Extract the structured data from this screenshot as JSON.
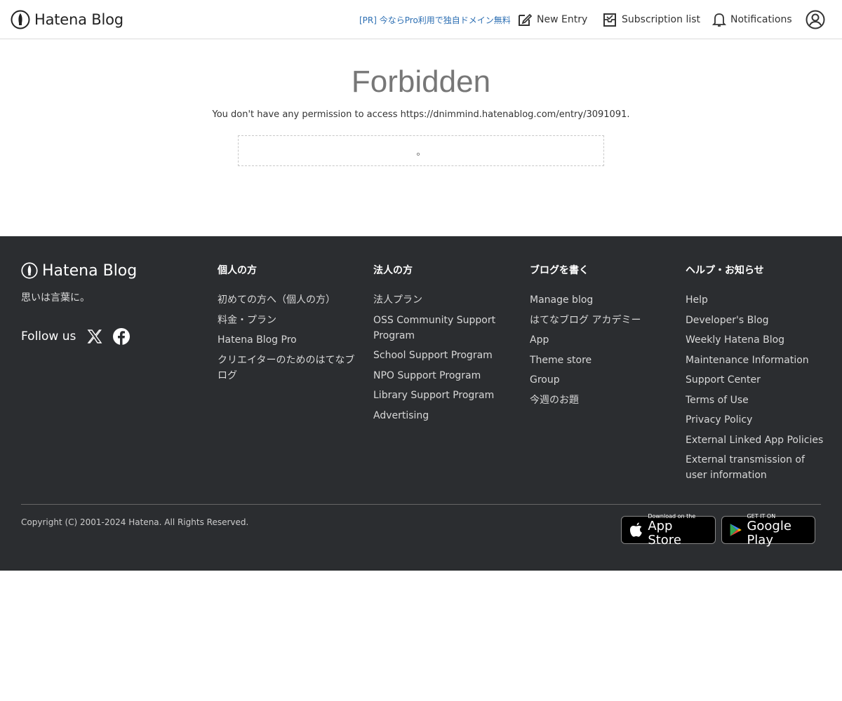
{
  "header": {
    "brand": "Hatena Blog",
    "pr_link": "[PR] 今ならPro利用で独自ドメイン無料",
    "new_entry": "New Entry",
    "subscription_list": "Subscription list",
    "notifications": "Notifications"
  },
  "main": {
    "title": "Forbidden",
    "message": "You don't have any permission to access https://dnimmind.hatenablog.com/entry/3091091.",
    "box_text": "。"
  },
  "footer": {
    "brand": "Hatena Blog",
    "tagline": "思いは言葉に。",
    "follow_label": "Follow us",
    "columns": [
      {
        "heading": "個人の方",
        "items": [
          "初めての方へ（個人の方）",
          "料金・プラン",
          "Hatena Blog Pro",
          "クリエイターのためのはてなブログ"
        ]
      },
      {
        "heading": "法人の方",
        "items": [
          "法人プラン",
          "OSS Community Support Program",
          "School Support Program",
          "NPO Support Program",
          "Library Support Program",
          "Advertising"
        ]
      },
      {
        "heading": "ブログを書く",
        "items": [
          "Manage blog",
          "はてなブログ アカデミー",
          "App",
          "Theme store",
          "Group",
          "今週のお題"
        ]
      },
      {
        "heading": "ヘルプ・お知らせ",
        "items": [
          "Help",
          "Developer's Blog",
          "Weekly Hatena Blog",
          "Maintenance Information",
          "Support Center",
          "Terms of Use",
          "Privacy Policy",
          "External Linked App Policies",
          "External transmission of user information"
        ]
      }
    ],
    "copyright": "Copyright (C) 2001-2024 Hatena. All Rights Reserved.",
    "app_store": {
      "small": "Download on the",
      "big": "App Store"
    },
    "google_play": {
      "small": "GET IT ON",
      "big": "Google Play"
    }
  }
}
